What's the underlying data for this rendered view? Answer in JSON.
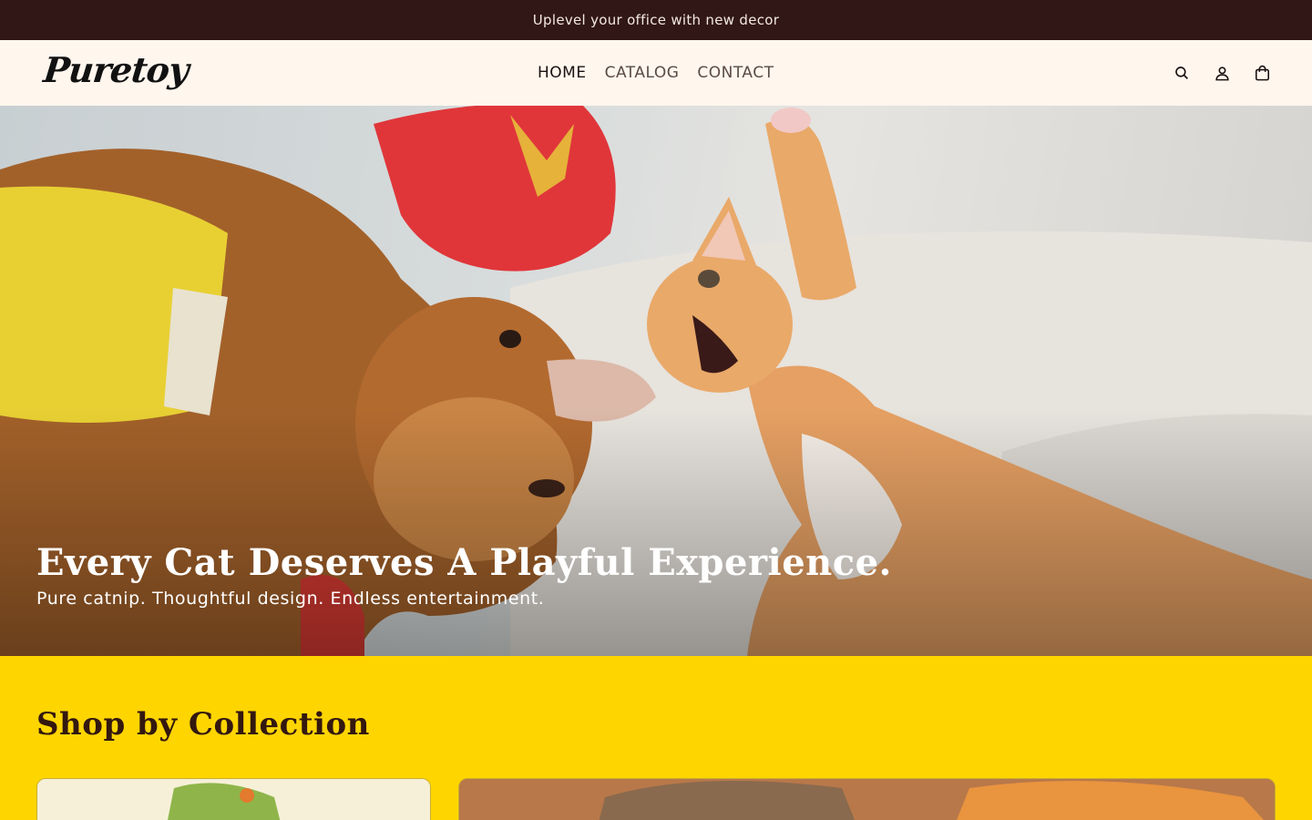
{
  "announcement": "Uplevel your office with new decor",
  "brand": {
    "logo_text": "Puretoy"
  },
  "nav": {
    "items": [
      {
        "label": "HOME",
        "active": true
      },
      {
        "label": "CATALOG",
        "active": false
      },
      {
        "label": "CONTACT",
        "active": false
      }
    ]
  },
  "header_icons": [
    "search-icon",
    "account-icon",
    "cart-icon"
  ],
  "hero": {
    "title": "Every Cat Deserves A Playful Experience.",
    "subtitle": "Pure catnip. Thoughtful design. Endless entertainment."
  },
  "collections": {
    "heading": "Shop by Collection"
  },
  "colors": {
    "announcement_bg": "#311716",
    "header_bg": "#fff6ee",
    "accent_yellow": "#ffd500",
    "heading_brown": "#33180f"
  }
}
